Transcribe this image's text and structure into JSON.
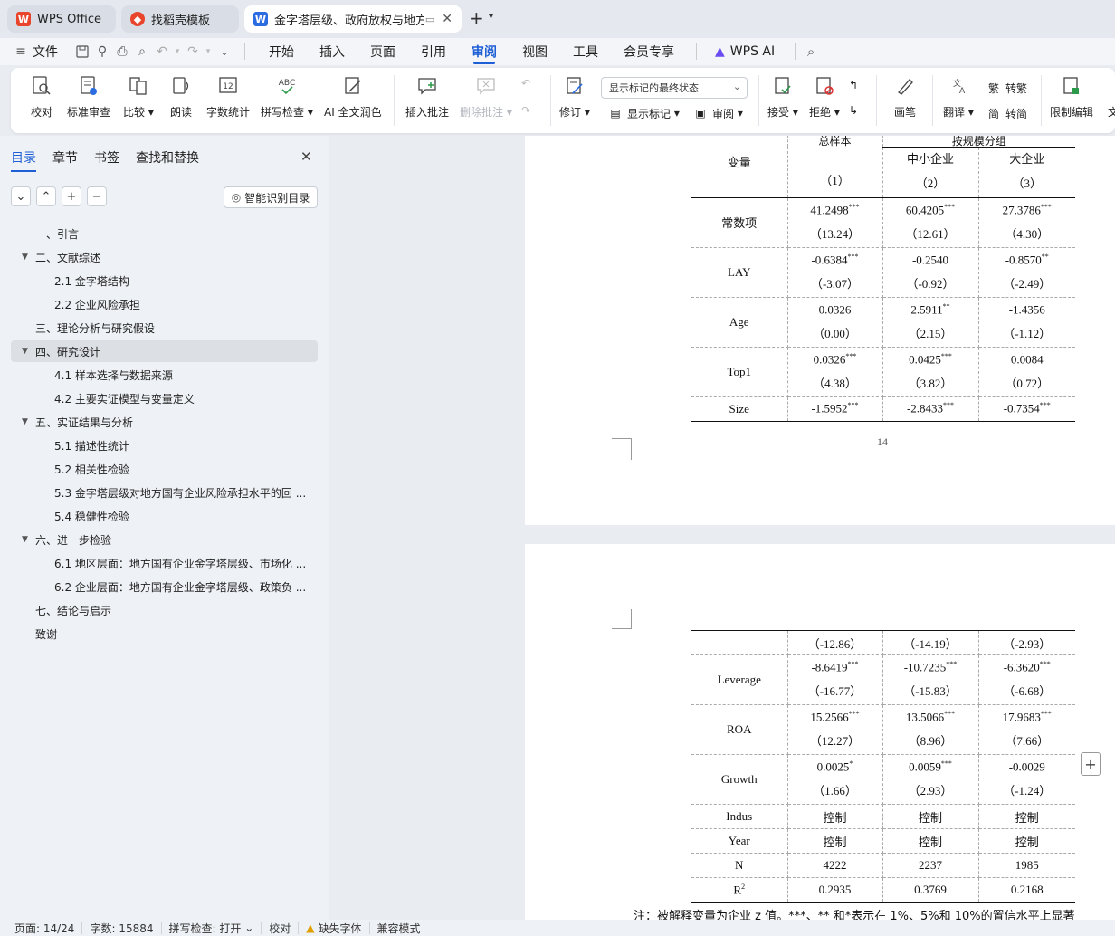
{
  "tabs": [
    {
      "label": "WPS Office",
      "icon": "wps-logo-icon"
    },
    {
      "label": "找稻壳模板",
      "icon": "docer-logo-icon"
    },
    {
      "label": "金字塔层级、政府放权与地方国",
      "icon": "word-doc-icon"
    }
  ],
  "menu": {
    "file": "文件",
    "items": [
      "开始",
      "插入",
      "页面",
      "引用",
      "审阅",
      "视图",
      "工具",
      "会员专享"
    ],
    "active": "审阅",
    "wps_ai": "WPS AI"
  },
  "ribbon": {
    "proofread": "校对",
    "standard_review": "标准审查",
    "compare": "比较",
    "read_aloud": "朗读",
    "word_count": "字数统计",
    "spell_check": "拼写检查",
    "ai_polish": "AI 全文润色",
    "insert_comment": "插入批注",
    "delete_comment": "删除批注",
    "track_changes": "修订",
    "markup_select": "显示标记的最终状态",
    "show_markup": "显示标记",
    "review": "审阅",
    "accept": "接受",
    "reject": "拒绝",
    "pen": "画笔",
    "translate": "翻译",
    "to_traditional": "转繁",
    "to_simplified": "转简",
    "restrict_edit": "限制编辑",
    "more_cut": "文"
  },
  "sidebar": {
    "tabs": [
      "目录",
      "章节",
      "书签",
      "查找和替换"
    ],
    "smart_button": "智能识别目录",
    "toc": [
      {
        "label": "一、引言",
        "level": 1,
        "expand": false
      },
      {
        "label": "二、文献综述",
        "level": 1,
        "expand": true
      },
      {
        "label": "2.1 金字塔结构",
        "level": 2,
        "expand": false
      },
      {
        "label": "2.2 企业风险承担",
        "level": 2,
        "expand": false
      },
      {
        "label": "三、理论分析与研究假设",
        "level": 1,
        "expand": false
      },
      {
        "label": "四、研究设计",
        "level": 1,
        "expand": true,
        "selected": true
      },
      {
        "label": "4.1 样本选择与数据来源",
        "level": 2,
        "expand": false
      },
      {
        "label": "4.2 主要实证模型与变量定义",
        "level": 2,
        "expand": false
      },
      {
        "label": "五、实证结果与分析",
        "level": 1,
        "expand": true
      },
      {
        "label": "5.1 描述性统计",
        "level": 2,
        "expand": false
      },
      {
        "label": "5.2 相关性检验",
        "level": 2,
        "expand": false
      },
      {
        "label": "5.3 金字塔层级对地方国有企业风险承担水平的回 ...",
        "level": 2,
        "expand": false
      },
      {
        "label": "5.4 稳健性检验",
        "level": 2,
        "expand": false
      },
      {
        "label": "六、进一步检验",
        "level": 1,
        "expand": true
      },
      {
        "label": "6.1 地区层面：地方国有企业金字塔层级、市场化 ...",
        "level": 2,
        "expand": false
      },
      {
        "label": "6.2 企业层面：地方国有企业金字塔层级、政策负 ...",
        "level": 2,
        "expand": false
      },
      {
        "label": "七、结论与启示",
        "level": 1,
        "expand": false
      },
      {
        "label": "致谢",
        "level": 1,
        "expand": false
      }
    ]
  },
  "table1": {
    "header_top_left": "总样本",
    "header_top_right": "按规模分组",
    "var_header": "变量",
    "cols": [
      {
        "name": "",
        "num": "（1）"
      },
      {
        "name": "中小企业",
        "num": "（2）"
      },
      {
        "name": "大企业",
        "num": "（3）"
      }
    ],
    "rows": [
      {
        "var": "常数项",
        "v": [
          "41.2498",
          "60.4205",
          "27.3786"
        ],
        "sig": [
          "***",
          "***",
          "***"
        ],
        "t": [
          "（13.24）",
          "（12.61）",
          "（4.30）"
        ]
      },
      {
        "var": "LAY",
        "v": [
          "-0.6384",
          "-0.2540",
          "-0.8570"
        ],
        "sig": [
          "***",
          "",
          "**"
        ],
        "t": [
          "（-3.07）",
          "（-0.92）",
          "（-2.49）"
        ]
      },
      {
        "var": "Age",
        "v": [
          "0.0326",
          "2.5911",
          "-1.4356"
        ],
        "sig": [
          "",
          "**",
          ""
        ],
        "t": [
          "（0.00）",
          "（2.15）",
          "（-1.12）"
        ]
      },
      {
        "var": "Top1",
        "v": [
          "0.0326",
          "0.0425",
          "0.0084"
        ],
        "sig": [
          "***",
          "***",
          ""
        ],
        "t": [
          "（4.38）",
          "（3.82）",
          "（0.72）"
        ]
      }
    ],
    "size_row": {
      "var": "Size",
      "v": [
        "-1.5952",
        "-2.8433",
        "-0.7354"
      ],
      "sig": [
        "***",
        "***",
        "***"
      ]
    }
  },
  "page_number": "14",
  "table2": {
    "first_row": [
      "（-12.86）",
      "（-14.19）",
      "（-2.93）"
    ],
    "rows": [
      {
        "var": "Leverage",
        "v": [
          "-8.6419",
          "-10.7235",
          "-6.3620"
        ],
        "sig": [
          "***",
          "***",
          "***"
        ],
        "t": [
          "（-16.77）",
          "（-15.83）",
          "（-6.68）"
        ]
      },
      {
        "var": "ROA",
        "v": [
          "15.2566",
          "13.5066",
          "17.9683"
        ],
        "sig": [
          "***",
          "***",
          "***"
        ],
        "t": [
          "（12.27）",
          "（8.96）",
          "（7.66）"
        ]
      },
      {
        "var": "Growth",
        "v": [
          "0.0025",
          "0.0059",
          "-0.0029"
        ],
        "sig": [
          "*",
          "***",
          ""
        ],
        "t": [
          "（1.66）",
          "（2.93）",
          "（-1.24）"
        ]
      }
    ],
    "simple_rows": [
      {
        "var": "Indus",
        "v": [
          "控制",
          "控制",
          "控制"
        ]
      },
      {
        "var": "Year",
        "v": [
          "控制",
          "控制",
          "控制"
        ]
      },
      {
        "var": "N",
        "v": [
          "4222",
          "2237",
          "1985"
        ]
      }
    ],
    "r2_row": {
      "var": "R",
      "sup": "2",
      "v": [
        "0.2935",
        "0.3769",
        "0.2168"
      ]
    }
  },
  "note": "注：被解释变量为企业 z 值。***、** 和*表示在 1%、5%和 10%的置信水平上显著",
  "status": {
    "page": "页面: 14/24",
    "words": "字数: 15884",
    "spell": "拼写检查: 打开",
    "proof": "校对",
    "missing_font": "缺失字体",
    "compat": "兼容模式"
  },
  "colors": {
    "accent": "#1f5fd6",
    "wps_red": "#e8452c",
    "doc_blue": "#2b6de1"
  }
}
